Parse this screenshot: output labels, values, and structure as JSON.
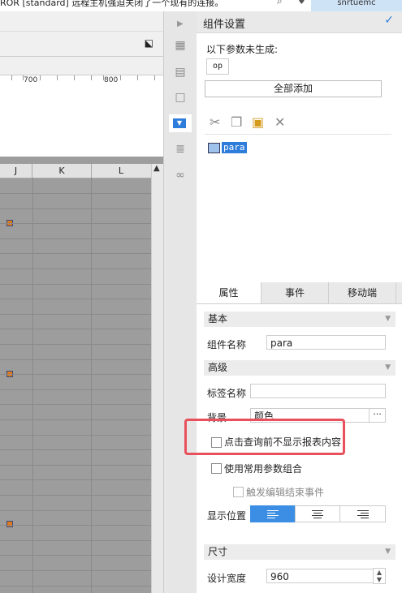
{
  "topbar": {
    "message": "ROR [standard] 远程主机强迫关闭了一个现有的连接。",
    "user": "snrtuemc"
  },
  "canvas": {
    "ruler_labels": [
      "700",
      "800"
    ],
    "columns": [
      "J",
      "K",
      "L"
    ]
  },
  "panel": {
    "title": "组件设置",
    "missing_params_label": "以下参数未生成:",
    "missing_param": "op",
    "add_all_label": "全部添加",
    "tree_item": "para",
    "tabs": [
      "属性",
      "事件",
      "移动端"
    ],
    "sections": {
      "basic": "基本",
      "advanced": "高级",
      "size": "尺寸"
    },
    "component_name_label": "组件名称",
    "component_name_value": "para",
    "tag_name_label": "标签名称",
    "tag_name_value": "",
    "background_label": "背景",
    "background_value": "颜色",
    "more_label": "···",
    "checkbox_no_report": "点击查询前不显示报表内容",
    "checkbox_common_params": "使用常用参数组合",
    "checkbox_trigger_edit": "触发编辑结束事件",
    "display_position_label": "显示位置",
    "design_width_label": "设计宽度",
    "design_width_value": "960"
  },
  "colors": {
    "accent": "#2f7ddb",
    "highlight": "#e8505b",
    "align_active": "#3b8ee3"
  }
}
